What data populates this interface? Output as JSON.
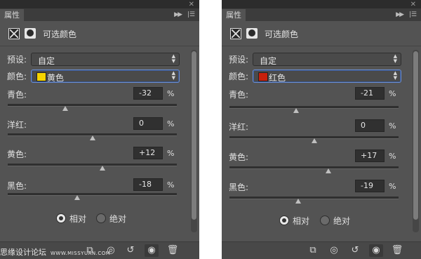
{
  "panels": [
    {
      "tab_label": "属性",
      "header_title": "可选颜色",
      "preset_label": "预设:",
      "preset_value": "自定",
      "color_label": "颜色:",
      "color_value": "黄色",
      "swatch_color": "#f5d300",
      "sliders": [
        {
          "label": "青色:",
          "value": "-32",
          "unit": "%",
          "level": -32
        },
        {
          "label": "洋红:",
          "value": "0",
          "unit": "%",
          "level": 0
        },
        {
          "label": "黄色:",
          "value": "+12",
          "unit": "%",
          "level": 12
        },
        {
          "label": "黑色:",
          "value": "-18",
          "unit": "%",
          "level": -18
        }
      ],
      "radio_relative": "相对",
      "radio_absolute": "绝对",
      "selected_mode": "relative",
      "watermark": "思缘设计论坛",
      "watermark_url": "WWW.MISSYUAN.COM"
    },
    {
      "tab_label": "属性",
      "header_title": "可选颜色",
      "preset_label": "预设:",
      "preset_value": "自定",
      "color_label": "颜色:",
      "color_value": "红色",
      "swatch_color": "#c8200c",
      "sliders": [
        {
          "label": "青色:",
          "value": "-21",
          "unit": "%",
          "level": -21
        },
        {
          "label": "洋红:",
          "value": "0",
          "unit": "%",
          "level": 0
        },
        {
          "label": "黄色:",
          "value": "+17",
          "unit": "%",
          "level": 17
        },
        {
          "label": "黑色:",
          "value": "-19",
          "unit": "%",
          "level": -19
        }
      ],
      "radio_relative": "相对",
      "radio_absolute": "绝对",
      "selected_mode": "relative"
    }
  ],
  "icons": [
    "collapse-icon",
    "panel-menu-icon",
    "adjustment-layer-icon",
    "layer-mask-icon",
    "clip-to-layer-icon",
    "view-previous-state-icon",
    "reset-icon",
    "visibility-eye-icon",
    "trash-icon"
  ]
}
